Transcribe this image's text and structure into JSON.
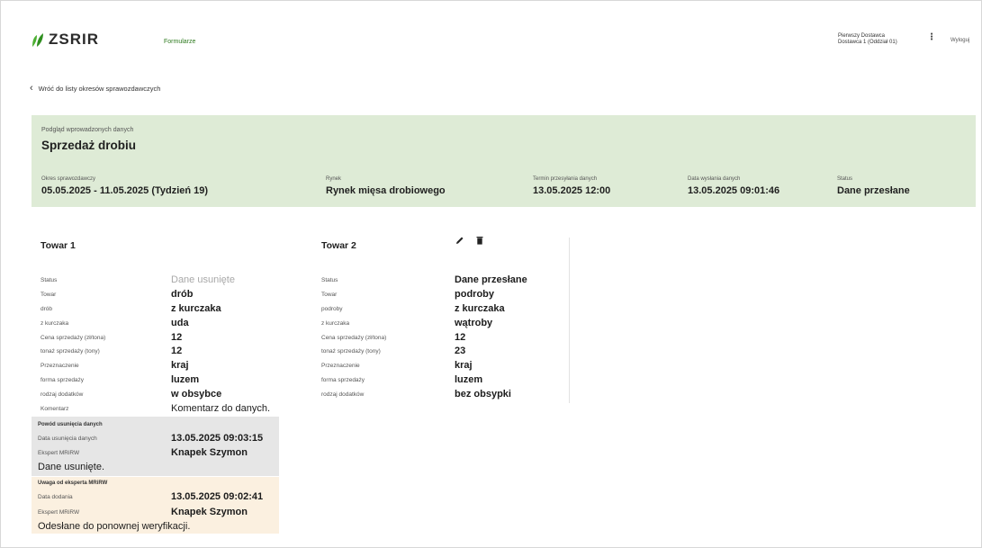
{
  "header": {
    "logo_text": "ZSRIR",
    "nav_forms": "Formularze",
    "user_line1": "Pierwszy Dostawca",
    "user_line2": "Dostawca 1 (Oddział 01)",
    "logout": "Wyloguj",
    "brand_green": "#4caf32"
  },
  "back_link": "Wróć do listy okresów sprawozdawczych",
  "banner": {
    "subtitle": "Podgląd wprowadzonych danych",
    "title": "Sprzedaż drobiu",
    "fields": [
      {
        "label": "Okres sprawozdawczy",
        "value": "05.05.2025 - 11.05.2025 (Tydzień 19)"
      },
      {
        "label": "Rynek",
        "value": "Rynek mięsa drobiowego"
      },
      {
        "label": "Termin przesyłania danych",
        "value": "13.05.2025 12:00"
      },
      {
        "label": "Data wysłania danych",
        "value": "13.05.2025 09:01:46"
      },
      {
        "label": "Status",
        "value": "Dane przesłane"
      }
    ],
    "bg_color": "#deebd6"
  },
  "towar1": {
    "title": "Towar 1",
    "rows": [
      {
        "label": "Status",
        "value": "Dane usunięte"
      },
      {
        "label": "Towar",
        "value": "drób"
      },
      {
        "label": "drób",
        "value": "z kurczaka"
      },
      {
        "label": "z kurczaka",
        "value": "uda"
      },
      {
        "label": "Cena sprzedaży (zł/tona)",
        "value": "12"
      },
      {
        "label": "tonaż sprzedaży (tony)",
        "value": "12"
      },
      {
        "label": "Przeznaczenie",
        "value": "kraj"
      },
      {
        "label": "forma sprzedaży",
        "value": "luzem"
      },
      {
        "label": "rodzaj dodatków",
        "value": "w obsybce"
      },
      {
        "label": "Komentarz",
        "value": "Komentarz do danych."
      }
    ],
    "removal": {
      "heading": "Powód usunięcia danych",
      "date_label": "Data usunięcia danych",
      "date_value": "13.05.2025 09:03:15",
      "expert_label": "Ekspert MRiRW",
      "expert_value": "Knapek Szymon",
      "note": "Dane usunięte."
    },
    "expert_note": {
      "heading": "Uwaga od eksperta MRiRW",
      "date_label": "Data dodania",
      "date_value": "13.05.2025 09:02:41",
      "expert_label": "Ekspert MRiRW",
      "expert_value": "Knapek Szymon",
      "note": "Odesłane do ponownej weryfikacji."
    }
  },
  "towar2": {
    "title": "Towar 2",
    "edit_icon": "pencil-icon",
    "delete_icon": "trash-icon",
    "rows": [
      {
        "label": "Status",
        "value": "Dane przesłane"
      },
      {
        "label": "Towar",
        "value": "podroby"
      },
      {
        "label": "podroby",
        "value": "z kurczaka"
      },
      {
        "label": "z kurczaka",
        "value": "wątroby"
      },
      {
        "label": "Cena sprzedaży (zł/tona)",
        "value": "12"
      },
      {
        "label": "tonaż sprzedaży (tony)",
        "value": "23"
      },
      {
        "label": "Przeznaczenie",
        "value": "kraj"
      },
      {
        "label": "forma sprzedaży",
        "value": "luzem"
      },
      {
        "label": "rodzaj dodatków",
        "value": "bez obsypki"
      }
    ]
  }
}
